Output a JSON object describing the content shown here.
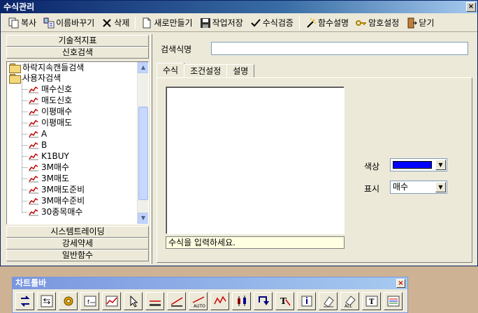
{
  "window": {
    "title": "수식관리",
    "close_label": "×"
  },
  "toolbar": {
    "copy": "복사",
    "rename": "이름바꾸기",
    "delete": "삭제",
    "new": "새로만들기",
    "save": "작업저장",
    "verify": "수식검증",
    "func_help": "함수설명",
    "password": "암호설정",
    "close": "닫기"
  },
  "left": {
    "categories_top": [
      "기술적지표",
      "신호검색"
    ],
    "tree": {
      "folder_1": "하락지속캔들검색",
      "folder_2": "사용자검색",
      "items": [
        "매수신호",
        "매도신호",
        "이평매수",
        "이평매도",
        "A",
        "B",
        "K1BUY",
        "3M매수",
        "3M매도",
        "3M매도준비",
        "3M매수준비",
        "30종목매수"
      ]
    },
    "categories_bottom": [
      "시스템트레이딩",
      "강세약세",
      "일반함수"
    ]
  },
  "right": {
    "search_label": "검색식명",
    "search_value": "",
    "tabs": [
      "수식",
      "조건설정",
      "설명"
    ],
    "formula_text": "",
    "hint": "수식을 입력하세요.",
    "color_label": "색상",
    "color_value": "#0000ff",
    "display_label": "표시",
    "display_value": "매수"
  },
  "chart_toolbar": {
    "title": "차트툴바",
    "close_label": "×",
    "buttons": [
      "swap-icon",
      "indicator-icon",
      "settings-icon",
      "formula-icon",
      "chart-add-icon",
      "cursor-icon",
      "line-icon",
      "trendline-icon",
      "auto-trend-icon",
      "wave-icon",
      "candle-icon",
      "arrow-icon",
      "text-tool-icon",
      "info-icon",
      "eraser-icon",
      "eraser-all-icon",
      "text-box-icon",
      "properties-icon"
    ]
  }
}
